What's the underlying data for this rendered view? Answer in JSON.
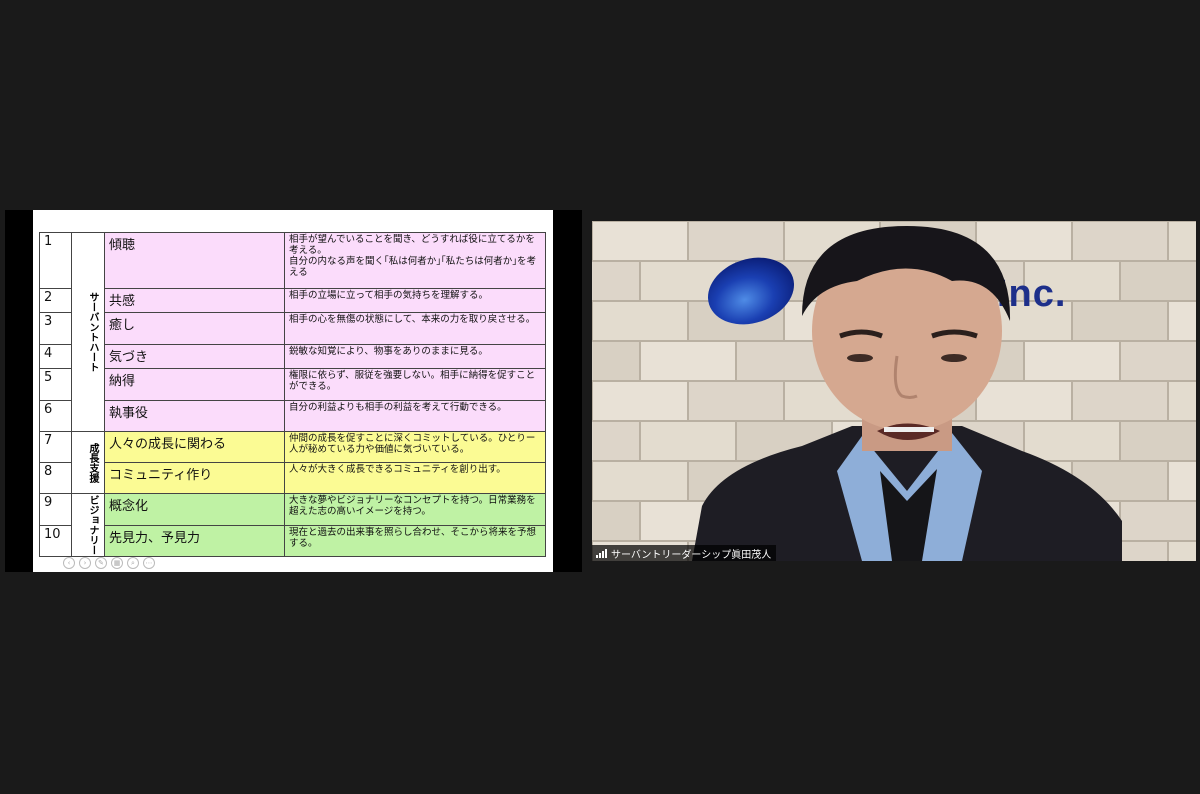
{
  "slide": {
    "rows": [
      {
        "num": "1",
        "name": "傾聴",
        "desc": "相手が望んでいることを聞き、どうすれば役に立てるかを考える。\n自分の内なる声を聞く｢私は何者か｣｢私たちは何者か｣を考える",
        "color": "pink"
      },
      {
        "num": "2",
        "name": "共感",
        "desc": "相手の立場に立って相手の気持ちを理解する。",
        "color": "pink"
      },
      {
        "num": "3",
        "name": "癒し",
        "desc": "相手の心を無傷の状態にして、本来の力を取り戻させる。",
        "color": "pink"
      },
      {
        "num": "4",
        "name": "気づき",
        "desc": "鋭敏な知覚により、物事をありのままに見る。",
        "color": "pink"
      },
      {
        "num": "5",
        "name": "納得",
        "desc": "権限に依らず、服従を強要しない。相手に納得を促すことができる。",
        "color": "pink"
      },
      {
        "num": "6",
        "name": "執事役",
        "desc": "自分の利益よりも相手の利益を考えて行動できる。",
        "color": "pink"
      },
      {
        "num": "7",
        "name": "人々の成長に関わる",
        "desc": "仲間の成長を促すことに深くコミットしている。ひとりー人が秘めている力や価値に気づいている。",
        "color": "yellow"
      },
      {
        "num": "8",
        "name": "コミュニティ作り",
        "desc": "人々が大きく成長できるコミュニティを創り出す。",
        "color": "yellow"
      },
      {
        "num": "9",
        "name": "概念化",
        "desc": "大きな夢やビジョナリーなコンセプトを持つ。日常業務を超えた志の高いイメージを持つ。",
        "color": "green"
      },
      {
        "num": "10",
        "name": "先見力、予見力",
        "desc": "現在と過去の出来事を照らし合わせ、そこから将来を予想する。",
        "color": "green"
      }
    ],
    "categories": {
      "servant_heart": "サーバントハート",
      "growth_support": "成長支援",
      "visionary": "ビジョナリー"
    }
  },
  "video": {
    "logo_text": "Inc.",
    "participant_name": "サーバントリーダーシップ眞田茂人"
  },
  "colors": {
    "pink": "#fbdcfb",
    "yellow": "#fbfb94",
    "green": "#bff2a4",
    "background": "#1a1a1a"
  }
}
